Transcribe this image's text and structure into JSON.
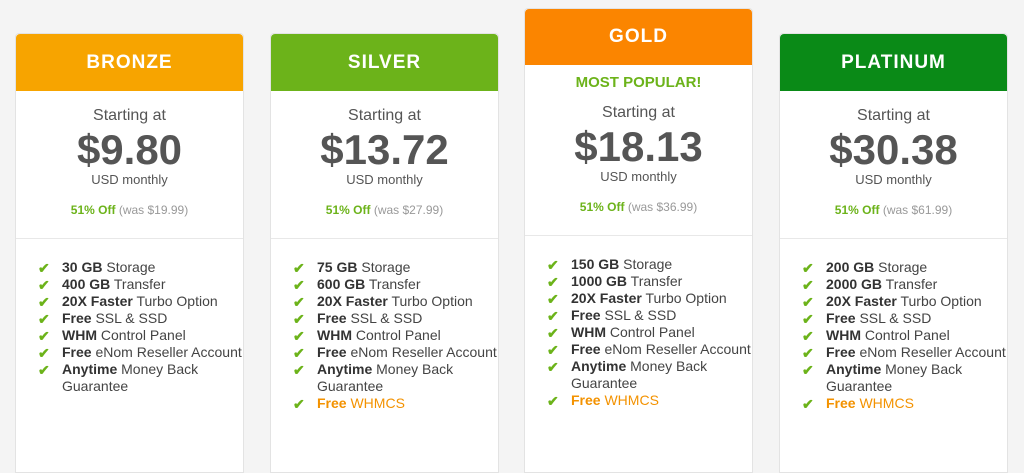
{
  "plans": [
    {
      "name": "BRONZE",
      "color": "#f7a400",
      "starting_label": "Starting at",
      "price": "$9.80",
      "period": "USD monthly",
      "discount": "51% Off",
      "was": "(was $19.99)",
      "features": [
        {
          "bold": "30 GB",
          "text": " Storage"
        },
        {
          "bold": "400 GB",
          "text": " Transfer"
        },
        {
          "bold": "20X Faster",
          "text": " Turbo Option"
        },
        {
          "bold": "Free",
          "text": " SSL & SSD"
        },
        {
          "bold": "WHM",
          "text": " Control Panel"
        },
        {
          "bold": "Free",
          "text": " eNom Reseller Account"
        },
        {
          "bold": "Anytime",
          "text": " Money Back Guarantee"
        }
      ]
    },
    {
      "name": "SILVER",
      "color": "#6cb31a",
      "starting_label": "Starting at",
      "price": "$13.72",
      "period": "USD monthly",
      "discount": "51% Off",
      "was": "(was $27.99)",
      "features": [
        {
          "bold": "75 GB",
          "text": " Storage"
        },
        {
          "bold": "600 GB",
          "text": " Transfer"
        },
        {
          "bold": "20X Faster",
          "text": " Turbo Option"
        },
        {
          "bold": "Free",
          "text": " SSL & SSD"
        },
        {
          "bold": "WHM",
          "text": " Control Panel"
        },
        {
          "bold": "Free",
          "text": " eNom Reseller Account"
        },
        {
          "bold": "Anytime",
          "text": " Money Back Guarantee"
        },
        {
          "bold": "Free",
          "text": " WHMCS",
          "highlight": true
        }
      ]
    },
    {
      "name": "GOLD",
      "color": "#fb8500",
      "badge": "MOST POPULAR!",
      "starting_label": "Starting at",
      "price": "$18.13",
      "period": "USD monthly",
      "discount": "51% Off",
      "was": "(was $36.99)",
      "features": [
        {
          "bold": "150 GB",
          "text": " Storage"
        },
        {
          "bold": "1000 GB",
          "text": " Transfer"
        },
        {
          "bold": "20X Faster",
          "text": " Turbo Option"
        },
        {
          "bold": "Free",
          "text": " SSL & SSD"
        },
        {
          "bold": "WHM",
          "text": " Control Panel"
        },
        {
          "bold": "Free",
          "text": " eNom Reseller Account"
        },
        {
          "bold": "Anytime",
          "text": " Money Back Guarantee"
        },
        {
          "bold": "Free",
          "text": " WHMCS",
          "highlight": true
        }
      ]
    },
    {
      "name": "PLATINUM",
      "color": "#0a8a17",
      "starting_label": "Starting at",
      "price": "$30.38",
      "period": "USD monthly",
      "discount": "51% Off",
      "was": "(was $61.99)",
      "features": [
        {
          "bold": "200 GB",
          "text": " Storage"
        },
        {
          "bold": "2000 GB",
          "text": " Transfer"
        },
        {
          "bold": "20X Faster",
          "text": " Turbo Option"
        },
        {
          "bold": "Free",
          "text": " SSL & SSD"
        },
        {
          "bold": "WHM",
          "text": " Control Panel"
        },
        {
          "bold": "Free",
          "text": " eNom Reseller Account"
        },
        {
          "bold": "Anytime",
          "text": " Money Back Guarantee"
        },
        {
          "bold": "Free",
          "text": " WHMCS",
          "highlight": true
        }
      ]
    }
  ],
  "check_icon": "checkmark-icon",
  "check_glyph": "✔"
}
